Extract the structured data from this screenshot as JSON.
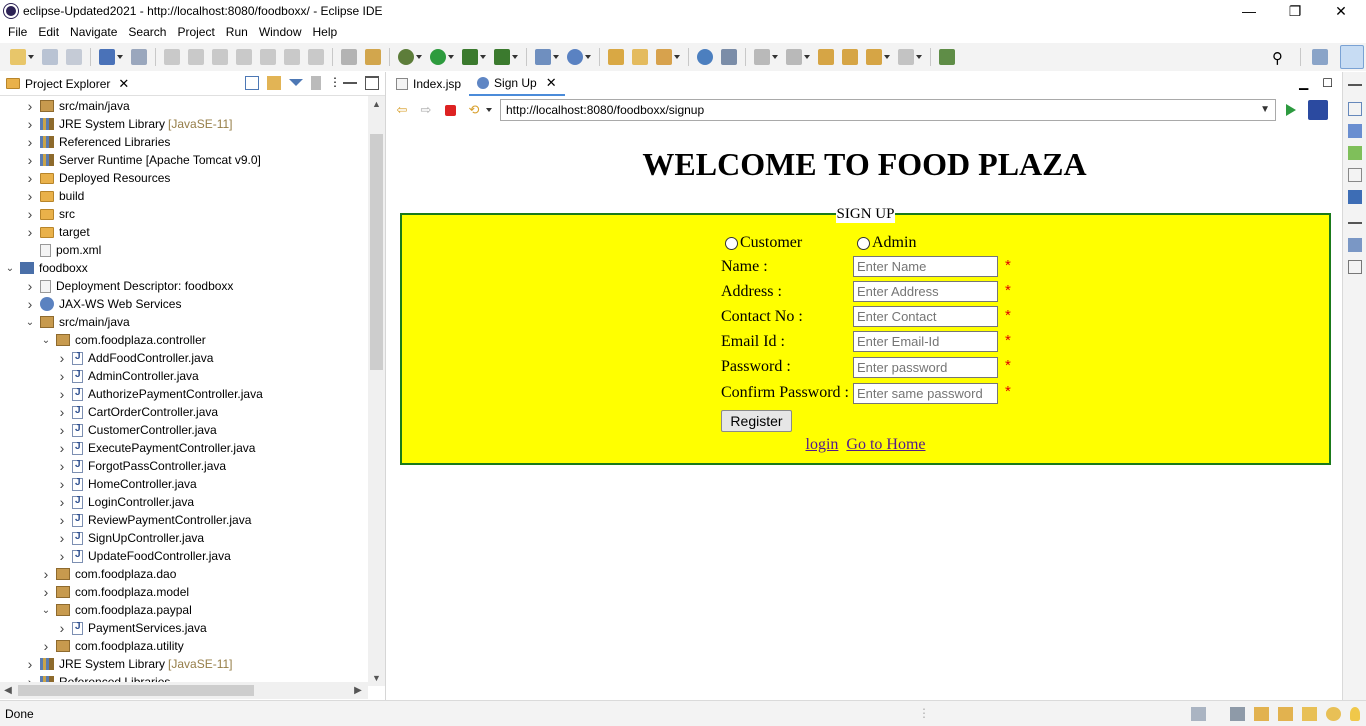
{
  "window": {
    "title": "eclipse-Updated2021 - http://localhost:8080/foodboxx/ - Eclipse IDE",
    "minimize": "—",
    "restore": "❐",
    "close": "✕"
  },
  "menu": [
    "File",
    "Edit",
    "Navigate",
    "Search",
    "Project",
    "Run",
    "Window",
    "Help"
  ],
  "project_explorer": {
    "tab_label": "Project Explorer",
    "rows": [
      {
        "label": "src/main/java",
        "tag": "",
        "icon": "package-folder-icon"
      },
      {
        "label": "JRE System Library",
        "tag": "[JavaSE-11]",
        "icon": "library-icon"
      },
      {
        "label": "Referenced Libraries",
        "tag": "",
        "icon": "library-icon"
      },
      {
        "label": "Server Runtime [Apache Tomcat v9.0]",
        "tag": "",
        "icon": "library-icon"
      },
      {
        "label": "Deployed Resources",
        "tag": "",
        "icon": "folder-icon"
      },
      {
        "label": "build",
        "tag": "",
        "icon": "folder-icon"
      },
      {
        "label": "src",
        "tag": "",
        "icon": "folder-icon"
      },
      {
        "label": "target",
        "tag": "",
        "icon": "folder-icon"
      },
      {
        "label": "pom.xml",
        "tag": "",
        "icon": "xml-file-icon"
      },
      {
        "label": "foodboxx",
        "tag": "",
        "icon": "web-project-icon"
      },
      {
        "label": "Deployment Descriptor: foodboxx",
        "tag": "",
        "icon": "descriptor-icon"
      },
      {
        "label": "JAX-WS Web Services",
        "tag": "",
        "icon": "web-services-icon"
      },
      {
        "label": "src/main/java",
        "tag": "",
        "icon": "package-folder-icon"
      },
      {
        "label": "com.foodplaza.controller",
        "tag": "",
        "icon": "package-icon"
      },
      {
        "label": "AddFoodController.java",
        "tag": "",
        "icon": "java-file-icon"
      },
      {
        "label": "AdminController.java",
        "tag": "",
        "icon": "java-file-icon"
      },
      {
        "label": "AuthorizePaymentController.java",
        "tag": "",
        "icon": "java-file-icon"
      },
      {
        "label": "CartOrderController.java",
        "tag": "",
        "icon": "java-file-icon"
      },
      {
        "label": "CustomerController.java",
        "tag": "",
        "icon": "java-file-icon"
      },
      {
        "label": "ExecutePaymentController.java",
        "tag": "",
        "icon": "java-file-icon"
      },
      {
        "label": "ForgotPassController.java",
        "tag": "",
        "icon": "java-file-icon"
      },
      {
        "label": "HomeController.java",
        "tag": "",
        "icon": "java-file-icon"
      },
      {
        "label": "LoginController.java",
        "tag": "",
        "icon": "java-file-icon"
      },
      {
        "label": "ReviewPaymentController.java",
        "tag": "",
        "icon": "java-file-icon"
      },
      {
        "label": "SignUpController.java",
        "tag": "",
        "icon": "java-file-icon"
      },
      {
        "label": "UpdateFoodController.java",
        "tag": "",
        "icon": "java-file-icon"
      },
      {
        "label": "com.foodplaza.dao",
        "tag": "",
        "icon": "package-icon"
      },
      {
        "label": "com.foodplaza.model",
        "tag": "",
        "icon": "package-icon"
      },
      {
        "label": "com.foodplaza.paypal",
        "tag": "",
        "icon": "package-icon"
      },
      {
        "label": "PaymentServices.java",
        "tag": "",
        "icon": "java-file-icon"
      },
      {
        "label": "com.foodplaza.utility",
        "tag": "",
        "icon": "package-icon"
      },
      {
        "label": "JRE System Library",
        "tag": "[JavaSE-11]",
        "icon": "library-icon"
      },
      {
        "label": "Referenced Libraries",
        "tag": "",
        "icon": "library-icon"
      }
    ]
  },
  "editor": {
    "tabs": [
      {
        "label": "Index.jsp",
        "active": false
      },
      {
        "label": "Sign Up",
        "active": true
      }
    ],
    "url": "http://localhost:8080/foodboxx/signup"
  },
  "signup_page": {
    "heading": "WELCOME TO FOOD PLAZA",
    "legend": "SIGN UP",
    "role_customer": "Customer",
    "role_admin": "Admin",
    "fields": [
      {
        "label": "Name :",
        "placeholder": "Enter Name"
      },
      {
        "label": "Address :",
        "placeholder": "Enter Address"
      },
      {
        "label": "Contact No :",
        "placeholder": "Enter Contact"
      },
      {
        "label": "Email Id :",
        "placeholder": "Enter Email-Id"
      },
      {
        "label": "Password :",
        "placeholder": "Enter password"
      },
      {
        "label": "Confirm Password :",
        "placeholder": "Enter same password"
      }
    ],
    "required_mark": "*",
    "register_button": "Register",
    "login_link": "login",
    "home_link": "Go to Home",
    "form_background": "#ffff00",
    "form_border": "#1a7a1a"
  },
  "status": {
    "text": "Done"
  }
}
